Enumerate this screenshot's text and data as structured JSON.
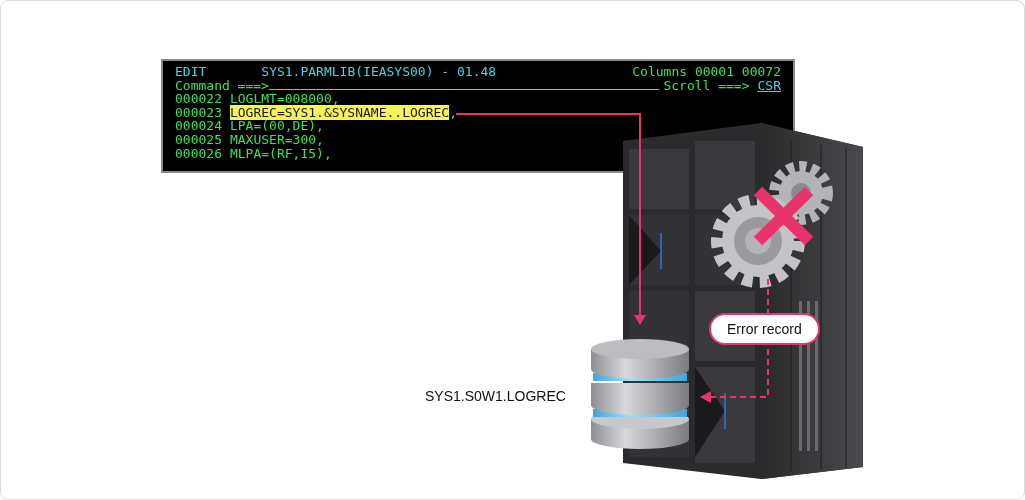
{
  "terminal": {
    "header": {
      "mode": "EDIT",
      "dataset": "SYS1.PARMLIB(IEASYS00) - 01.48",
      "columns": "Columns 00001 00072"
    },
    "command": {
      "label": "Command ===>",
      "scroll_label": "Scroll ===>",
      "scroll_value": "CSR"
    },
    "lines": [
      {
        "number": "000022",
        "text": "LOGLMT=008000,",
        "highlighted": false
      },
      {
        "number": "000023",
        "text": "LOGREC=SYS1.&SYSNAME..LOGREC",
        "suffix": ",",
        "highlighted": true
      },
      {
        "number": "000024",
        "text": "LPA=(00,DE),",
        "highlighted": false
      },
      {
        "number": "000025",
        "text": "MAXUSER=300,",
        "highlighted": false
      },
      {
        "number": "000026",
        "text": "MLPA=(RF,I5),",
        "highlighted": false
      }
    ]
  },
  "dataset_label": "SYS1.S0W1.LOGREC",
  "callout": "Error record"
}
